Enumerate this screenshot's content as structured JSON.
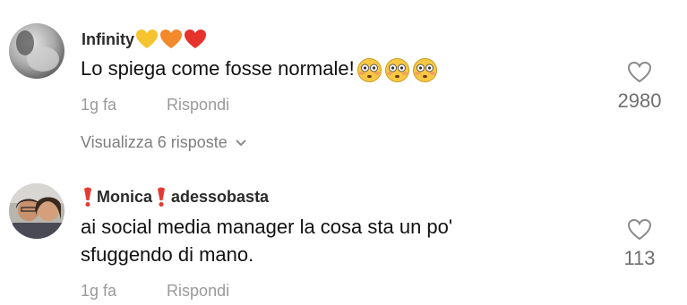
{
  "comments": [
    {
      "author": "Infinity",
      "text": "Lo spiega come fosse normale!",
      "time": "1g fa",
      "reply_label": "Rispondi",
      "likes": "2980",
      "view_replies": "Visualizza 6 risposte",
      "author_badges": [
        "yellow-heart",
        "orange-heart",
        "red-heart"
      ],
      "text_emojis": [
        "flushed-face",
        "flushed-face",
        "flushed-face"
      ]
    },
    {
      "author_prefix_icon": "red-exclamation",
      "author": "Monica",
      "author_suffix": "adessobasta",
      "text_line1": "ai social media manager la cosa sta un po'",
      "text_line2": "sfuggendo di mano.",
      "time": "1g fa",
      "reply_label": "Rispondi",
      "likes": "113"
    }
  ],
  "colors": {
    "meta": "#9a9a9a",
    "like_count": "#6f6f6f",
    "text": "#111111",
    "yellow_heart": "#f5c430",
    "orange_heart": "#f2892a",
    "red_heart": "#e5322b"
  }
}
